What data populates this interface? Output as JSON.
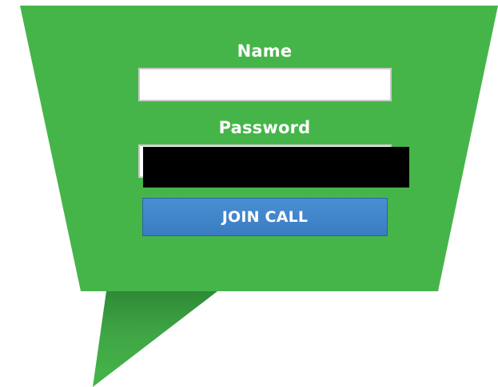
{
  "form": {
    "name_label": "Name",
    "name_value": "",
    "password_label": "Password",
    "password_value": "",
    "join_button_label": "JOIN CALL"
  },
  "colors": {
    "bubble": "#46b549",
    "bubble_tail_dark": "#2e8a36",
    "button": "#3a7cc2",
    "label_text": "#ffffff"
  }
}
